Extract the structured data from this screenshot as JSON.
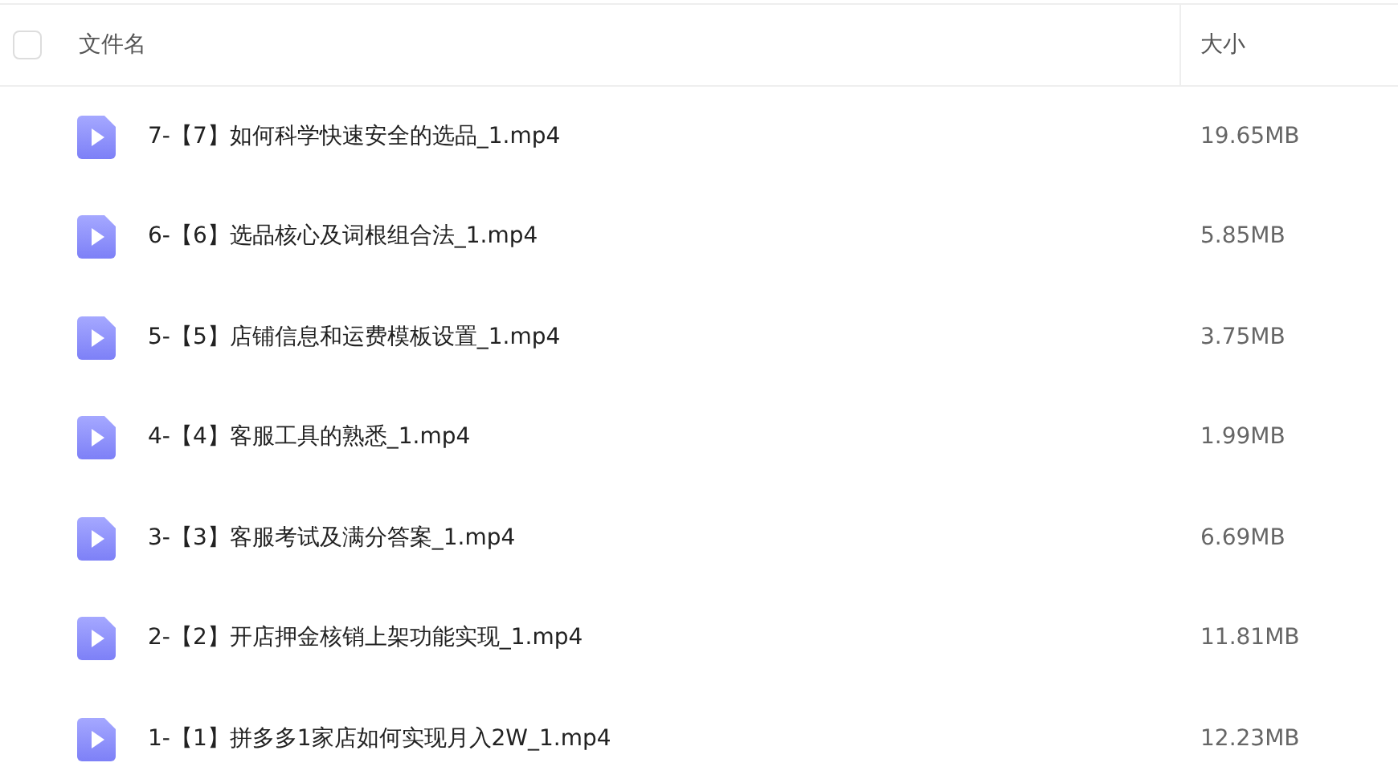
{
  "table": {
    "select_all": {
      "checked": false
    },
    "columns": [
      "文件名",
      "大小"
    ],
    "rows": [
      {
        "name": "7-【7】如何科学快速安全的选品_1.mp4",
        "size": "19.65MB"
      },
      {
        "name": "6-【6】选品核心及词根组合法_1.mp4",
        "size": "5.85MB"
      },
      {
        "name": "5-【5】店铺信息和运费模板设置_1.mp4",
        "size": "3.75MB"
      },
      {
        "name": "4-【4】客服工具的熟悉_1.mp4",
        "size": "1.99MB"
      },
      {
        "name": "3-【3】客服考试及满分答案_1.mp4",
        "size": "6.69MB"
      },
      {
        "name": "2-【2】开店押金核销上架功能实现_1.mp4",
        "size": "11.81MB"
      },
      {
        "name": "1-【1】拼多多1家店如何实现月入2W_1.mp4",
        "size": "12.23MB"
      }
    ]
  }
}
